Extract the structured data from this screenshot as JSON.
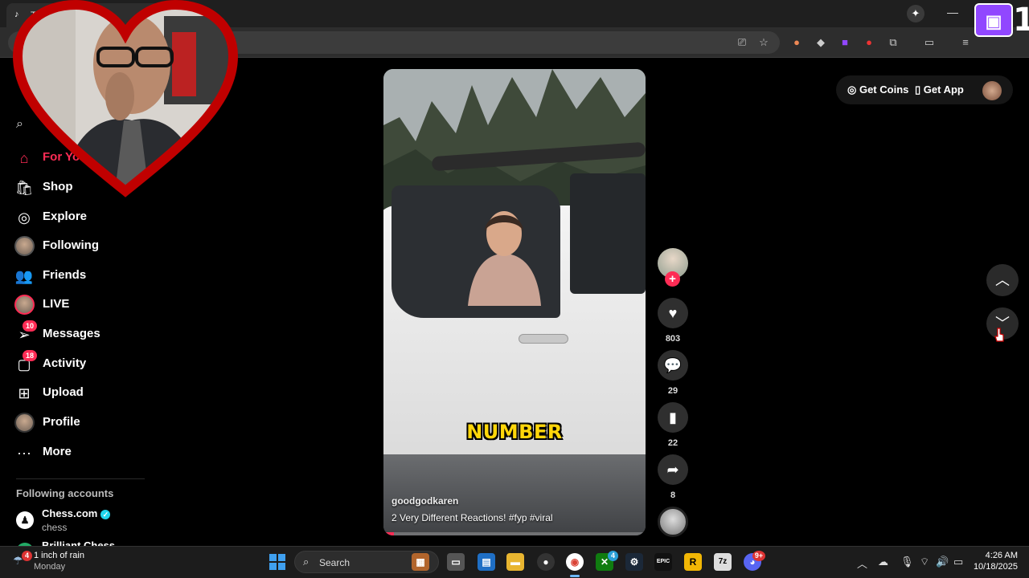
{
  "browser": {
    "tab_icon": "tiktok-icon",
    "tab_title": "T",
    "sparkle_icon": "sparkle-icon",
    "toolbar_icons": [
      "cast-icon",
      "star-icon",
      "color-ext-icon",
      "diamond-ext-icon",
      "twitch-ext-icon",
      "shield-ext-icon",
      "extensions-icon",
      "sidebar-icon",
      "media-icon",
      "profile-icon",
      "menu-icon"
    ]
  },
  "twitch_overlay": {
    "icon": "twitch-icon",
    "count": "1"
  },
  "sidebar": {
    "items": [
      {
        "label": "For You",
        "icon": "home-icon",
        "active": true
      },
      {
        "label": "Shop",
        "icon": "shop-icon"
      },
      {
        "label": "Explore",
        "icon": "compass-icon"
      },
      {
        "label": "Following",
        "icon": "following-avatar"
      },
      {
        "label": "Friends",
        "icon": "friends-icon"
      },
      {
        "label": "LIVE",
        "icon": "live-avatar"
      },
      {
        "label": "Messages",
        "icon": "messages-icon",
        "badge": "10"
      },
      {
        "label": "Activity",
        "icon": "activity-icon",
        "badge": "18"
      },
      {
        "label": "Upload",
        "icon": "upload-icon"
      },
      {
        "label": "Profile",
        "icon": "profile-avatar"
      },
      {
        "label": "More",
        "icon": "more-icon"
      }
    ],
    "following_title": "Following accounts",
    "accounts": [
      {
        "name": "Chess.com",
        "handle": "chess",
        "verified": true
      },
      {
        "name": "Brilliant Chess"
      }
    ]
  },
  "video": {
    "caption_word": "NUMBER",
    "author": "goodgodkaren",
    "description": "2 Very Different Reactions! #fyp  #viral",
    "progress": 0.04
  },
  "actions": {
    "likes": "803",
    "comments": "29",
    "saves": "22",
    "shares": "8"
  },
  "top_right": {
    "coins_label": "Get Coins",
    "app_label": "Get App"
  },
  "taskbar": {
    "weather_badge": "4",
    "weather_title": "1 inch of rain",
    "weather_sub": "Monday",
    "search_placeholder": "Search",
    "clock_time": "4:26 AM",
    "clock_date": "10/18/2025",
    "xbox_badge": "4",
    "discord_badge": "9+"
  },
  "colors": {
    "accent": "#fe2c55",
    "twitch": "#9147ff",
    "caption": "#ffd60a"
  }
}
